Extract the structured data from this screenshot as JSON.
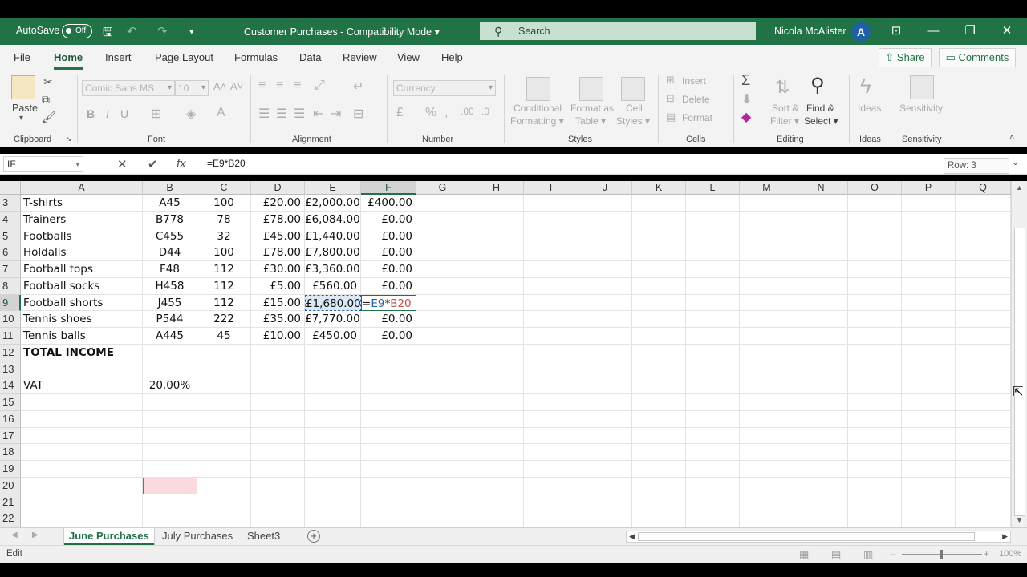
{
  "titlebar": {
    "autosave_label": "AutoSave",
    "autosave_state": "Off",
    "document_title": "Customer Purchases  -  Compatibility Mode  ▾",
    "search_placeholder": "Search",
    "user_name": "Nicola McAlister",
    "avatar_initial": "A",
    "accent_color": "#217346"
  },
  "menu": {
    "tabs": [
      "File",
      "Home",
      "Insert",
      "Page Layout",
      "Formulas",
      "Data",
      "Review",
      "View",
      "Help"
    ],
    "active_tab": "Home",
    "share_label": "Share",
    "comments_label": "Comments"
  },
  "ribbon": {
    "clipboard": {
      "paste_label": "Paste",
      "group_label": "Clipboard"
    },
    "font": {
      "font_name": "Comic Sans MS",
      "font_size": "10",
      "bold": "B",
      "italic": "I",
      "underline": "U",
      "group_label": "Font"
    },
    "alignment": {
      "group_label": "Alignment"
    },
    "number": {
      "format": "Currency",
      "group_label": "Number"
    },
    "styles": {
      "conditional_formatting": [
        "Conditional",
        "Formatting ▾"
      ],
      "format_as_table": [
        "Format as",
        "Table ▾"
      ],
      "cell_styles": [
        "Cell",
        "Styles ▾"
      ],
      "group_label": "Styles"
    },
    "cells": {
      "insert": "Insert",
      "delete": "Delete",
      "format": "Format",
      "group_label": "Cells"
    },
    "editing": {
      "sort_filter": [
        "Sort &",
        "Filter ▾"
      ],
      "find_select": [
        "Find &",
        "Select ▾"
      ],
      "group_label": "Editing"
    },
    "ideas": {
      "label": "Ideas",
      "group_label": "Ideas"
    },
    "sensitivity": {
      "label": "Sensitivity",
      "group_label": "Sensitivity"
    }
  },
  "formula_bar": {
    "name_box": "IF",
    "formula": "=E9*B20"
  },
  "grid": {
    "columns": [
      "A",
      "B",
      "C",
      "D",
      "E",
      "F",
      "G",
      "H",
      "I",
      "J",
      "K",
      "L",
      "M",
      "N",
      "O",
      "P",
      "Q"
    ],
    "active_column": "F",
    "active_row": "9",
    "rows": [
      {
        "num": "3",
        "cells": [
          "T-shirts",
          "A45",
          "100",
          "£20.00",
          "£2,000.00",
          "£400.00"
        ]
      },
      {
        "num": "4",
        "cells": [
          "Trainers",
          "B778",
          "78",
          "£78.00",
          "£6,084.00",
          "£0.00"
        ]
      },
      {
        "num": "5",
        "cells": [
          "Footballs",
          "C455",
          "32",
          "£45.00",
          "£1,440.00",
          "£0.00"
        ]
      },
      {
        "num": "6",
        "cells": [
          "Holdalls",
          "D44",
          "100",
          "£78.00",
          "£7,800.00",
          "£0.00"
        ]
      },
      {
        "num": "7",
        "cells": [
          "Football tops",
          "F48",
          "112",
          "£30.00",
          "£3,360.00",
          "£0.00"
        ]
      },
      {
        "num": "8",
        "cells": [
          "Football socks",
          "H458",
          "112",
          "£5.00",
          "£560.00",
          "£0.00"
        ]
      },
      {
        "num": "9",
        "cells": [
          "Football shorts",
          "J455",
          "112",
          "£15.00",
          "£1,680.00",
          ""
        ]
      },
      {
        "num": "10",
        "cells": [
          "Tennis shoes",
          "P544",
          "222",
          "£35.00",
          "£7,770.00",
          "£0.00"
        ]
      },
      {
        "num": "11",
        "cells": [
          "Tennis balls",
          "A445",
          "45",
          "£10.00",
          "£450.00",
          "£0.00"
        ]
      },
      {
        "num": "12",
        "cells": [
          "TOTAL INCOME",
          "",
          "",
          "",
          "",
          ""
        ]
      },
      {
        "num": "13",
        "cells": [
          "",
          "",
          "",
          "",
          "",
          ""
        ]
      },
      {
        "num": "14",
        "cells": [
          "VAT",
          "20.00%",
          "",
          "",
          "",
          ""
        ]
      },
      {
        "num": "15",
        "cells": [
          "",
          "",
          "",
          "",
          "",
          ""
        ]
      },
      {
        "num": "16",
        "cells": [
          "",
          "",
          "",
          "",
          "",
          ""
        ]
      },
      {
        "num": "17",
        "cells": [
          "",
          "",
          "",
          "",
          "",
          ""
        ]
      },
      {
        "num": "18",
        "cells": [
          "",
          "",
          "",
          "",
          "",
          ""
        ]
      },
      {
        "num": "19",
        "cells": [
          "",
          "",
          "",
          "",
          "",
          ""
        ]
      },
      {
        "num": "20",
        "cells": [
          "",
          "",
          "",
          "",
          "",
          ""
        ]
      },
      {
        "num": "21",
        "cells": [
          "",
          "",
          "",
          "",
          "",
          ""
        ]
      },
      {
        "num": "22",
        "cells": [
          "",
          "",
          "",
          "",
          "",
          ""
        ]
      }
    ],
    "editing_formula": {
      "prefix": "=",
      "ref1": "E9",
      "op": "*",
      "ref2": "B20"
    },
    "row_tooltip": "Row: 3"
  },
  "sheets": {
    "tabs": [
      "June Purchases",
      "July Purchases",
      "Sheet3"
    ],
    "active": "June Purchases"
  },
  "status": {
    "mode": "Edit",
    "zoom": "100%"
  }
}
